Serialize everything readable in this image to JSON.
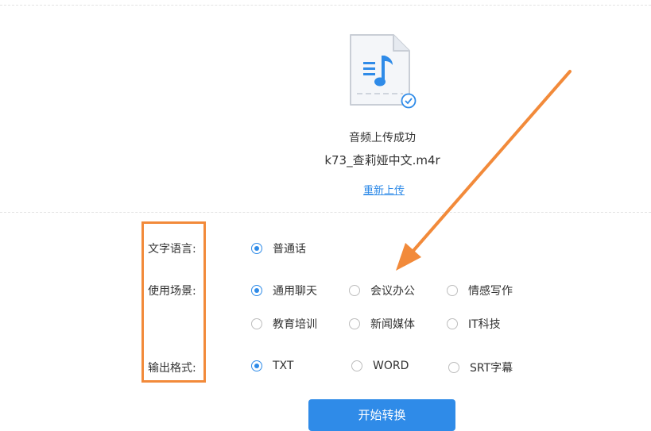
{
  "upload": {
    "status_text": "音频上传成功",
    "file_name": "k73_查莉娅中文.m4r",
    "reupload_link": "重新上传"
  },
  "form": {
    "language": {
      "label": "文字语言:",
      "options": [
        {
          "label": "普通话",
          "selected": true
        }
      ]
    },
    "scene": {
      "label": "使用场景:",
      "options": [
        {
          "label": "通用聊天",
          "selected": true
        },
        {
          "label": "会议办公",
          "selected": false
        },
        {
          "label": "情感写作",
          "selected": false
        },
        {
          "label": "教育培训",
          "selected": false
        },
        {
          "label": "新闻媒体",
          "selected": false
        },
        {
          "label": "IT科技",
          "selected": false
        }
      ]
    },
    "format": {
      "label": "输出格式:",
      "options": [
        {
          "label": "TXT",
          "selected": true
        },
        {
          "label": "WORD",
          "selected": false
        },
        {
          "label": "SRT字幕",
          "selected": false
        }
      ]
    }
  },
  "actions": {
    "start_label": "开始转换"
  },
  "colors": {
    "accent": "#2f8be8",
    "annotation": "#f28a3a"
  },
  "icons": {
    "file": "music-file-icon",
    "check": "check-badge-icon"
  }
}
